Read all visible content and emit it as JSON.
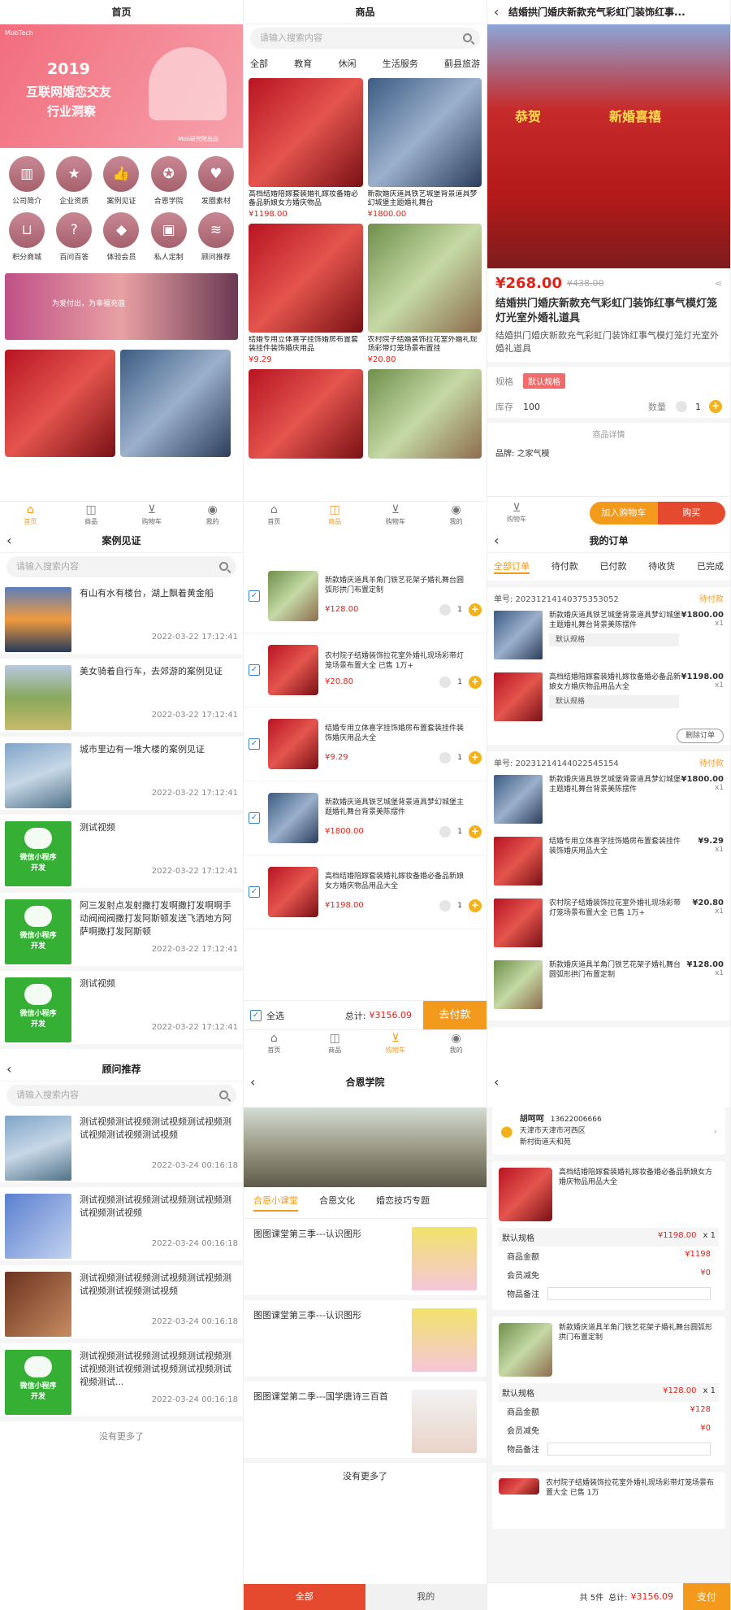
{
  "home": {
    "title": "首页",
    "banner_year": "2019",
    "banner_line1": "互联网婚恋交友",
    "banner_line2": "行业洞察",
    "banner_logo": "MobTech",
    "banner_sub": "Mob研究院出品",
    "icons": [
      {
        "label": "公司简介",
        "icon": "building-icon"
      },
      {
        "label": "企业资质",
        "icon": "star-icon"
      },
      {
        "label": "案例见证",
        "icon": "thumbs-up-icon"
      },
      {
        "label": "合恩学院",
        "icon": "medal-icon"
      },
      {
        "label": "发圈素材",
        "icon": "heart-icon"
      },
      {
        "label": "积分商城",
        "icon": "basket-icon"
      },
      {
        "label": "百问百答",
        "icon": "question-search-icon"
      },
      {
        "label": "体验会员",
        "icon": "graduation-cap-icon"
      },
      {
        "label": "私人定制",
        "icon": "gift-icon"
      },
      {
        "label": "顾问推荐",
        "icon": "layers-icon"
      }
    ],
    "couple_text": "为爱付出，为幸福充值",
    "tabs": [
      "首页",
      "商品",
      "购物车",
      "我的"
    ]
  },
  "goods": {
    "title": "商品",
    "search_placeholder": "请输入搜索内容",
    "tabs": [
      "全部",
      "教育",
      "休闲",
      "生活服务",
      "蓟县旅游"
    ],
    "items": [
      {
        "title": "高档结婚陪嫁套装婚礼嫁妆备婚必备品新娘女方婚庆物品",
        "price": "¥1198.00"
      },
      {
        "title": "新款婚庆道具铁艺城堡背景道具梦幻城堡主题婚礼舞台",
        "price": "¥1800.00"
      },
      {
        "title": "结婚专用立体喜字挂饰婚房布置套装挂件装饰婚庆用品",
        "price": "¥9.29"
      },
      {
        "title": "农村院子结婚装饰拉花室外婚礼现场彩带灯笼场景布置挂",
        "price": "¥20.80"
      }
    ]
  },
  "detail": {
    "title": "结婚拱门婚庆新款充气彩虹门装饰红事...",
    "price": "¥268.00",
    "orig_price": "¥438.00",
    "name": "结婚拱门婚庆新款充气彩虹门装饰红事气模灯笼灯光室外婚礼道具",
    "desc": "结婚拱门婚庆新款充气彩虹门装饰红事气模灯笼灯光室外婚礼道具",
    "spec_label": "规格",
    "spec_value": "默认规格",
    "stock_label": "库存",
    "stock": "100",
    "qty_label": "数量",
    "qty": "1",
    "detail_header": "商品详情",
    "brand": "品牌: 之家气模",
    "add_cart": "加入购物车",
    "buy": "购买",
    "shop_label": "购物车",
    "photo_text1": "恭贺",
    "photo_text2": "新婚喜禧"
  },
  "cases": {
    "title": "案例见证",
    "search_placeholder": "请输入搜索内容",
    "items": [
      {
        "text": "有山有水有楼台，湖上飘着黄金船",
        "time": "2022-03-22 17:12:41"
      },
      {
        "text": "美女骑着自行车，去郊游的案例见证",
        "time": "2022-03-22 17:12:41"
      },
      {
        "text": "城市里边有一堆大楼的案例见证",
        "time": "2022-03-22 17:12:41"
      },
      {
        "text": "测试视频",
        "time": "2022-03-22 17:12:41"
      },
      {
        "text": "阿三发射点发射撒打发啊撒打发啊啊手动阀阀阀撒打发阿斯顿发送飞洒地方阿萨啊撒打发阿斯顿",
        "time": "2022-03-22 17:12:41"
      },
      {
        "text": "测试视频",
        "time": "2022-03-22 17:12:41"
      }
    ],
    "wechat_line1": "微信小程序",
    "wechat_line2": "开发"
  },
  "cart": {
    "items": [
      {
        "title": "新款婚庆道具羊角门铁艺花架子婚礼舞台圆弧形拱门布置定制",
        "price": "¥128.00",
        "qty": "1"
      },
      {
        "title": "农村院子结婚装饰拉花室外婚礼现场彩带灯笼场景布置大全 已售 1万+",
        "price": "¥20.80",
        "qty": "1"
      },
      {
        "title": "结婚专用立体喜字挂饰婚房布置套装挂件装饰婚庆用品大全",
        "price": "¥9.29",
        "qty": "1"
      },
      {
        "title": "新款婚庆道具铁艺城堡背景道具梦幻城堡主题婚礼舞台背景美陈摆件",
        "price": "¥1800.00",
        "qty": "1"
      },
      {
        "title": "高档结婚陪嫁套装婚礼嫁妆备婚必备品新娘女方婚庆物品用品大全",
        "price": "¥1198.00",
        "qty": "1"
      }
    ],
    "select_all": "全选",
    "total_label": "总计:",
    "total": "¥3156.09",
    "checkout": "去付款",
    "tabs": [
      "首页",
      "商品",
      "购物车",
      "我的"
    ]
  },
  "orders": {
    "title": "我的订单",
    "tabs": [
      "全部订单",
      "待付款",
      "已付款",
      "待收货",
      "已完成"
    ],
    "order1": {
      "no": "单号: 20231214140375353052",
      "status": "待付款",
      "items": [
        {
          "title": "新款婚庆道具铁艺城堡背景道具梦幻城堡主题婚礼舞台背景美陈摆件",
          "price": "¥1800.00",
          "qty": "x1",
          "spec": "默认规格"
        },
        {
          "title": "高档结婚陪嫁套装婚礼嫁妆备婚必备品新娘女方婚庆物品用品大全",
          "price": "¥1198.00",
          "qty": "x1",
          "spec": "默认规格"
        }
      ],
      "delete": "删除订单"
    },
    "order2": {
      "no": "单号: 20231214144022545154",
      "status": "待付款",
      "items": [
        {
          "title": "新款婚庆道具铁艺城堡背景道具梦幻城堡主题婚礼舞台背景美陈摆件",
          "price": "¥1800.00",
          "qty": "x1"
        },
        {
          "title": "结婚专用立体喜字挂饰婚房布置套装挂件装饰婚庆用品大全",
          "price": "¥9.29",
          "qty": "x1"
        },
        {
          "title": "农村院子结婚装饰拉花室外婚礼现场彩带灯笼场景布置大全 已售 1万+",
          "price": "¥20.80",
          "qty": "x1"
        },
        {
          "title": "新款婚庆道具羊角门铁艺花架子婚礼舞台圆弧形拱门布置定制",
          "price": "¥128.00",
          "qty": "x1"
        }
      ]
    }
  },
  "advisors": {
    "title": "顾问推荐",
    "search_placeholder": "请输入搜索内容",
    "items": [
      {
        "text": "测试视频测试视频测试视频测试视频测试视频测试视频测试视频",
        "time": "2022-03-24 00:16:18"
      },
      {
        "text": "测试视频测试视频测试视频测试视频测试视频测试视频",
        "time": "2022-03-24 00:16:18"
      },
      {
        "text": "测试视频测试视频测试视频测试视频测试视频测试视频测试视频",
        "time": "2022-03-24 00:16:18"
      },
      {
        "text": "测试视频测试视频测试视频测试视频测试视频测试视频测试视频测试视频测试视频测试...",
        "time": "2022-03-24 00:16:18"
      }
    ],
    "more": "没有更多了"
  },
  "school": {
    "title": "合恩学院",
    "tabs": [
      "合恩小课堂",
      "合恩文化",
      "婚恋技巧专题"
    ],
    "courses": [
      "图图课堂第三季---认识图形",
      "图图课堂第三季---认识图形",
      "图图课堂第二季---国学唐诗三百首"
    ],
    "more": "没有更多了",
    "bottom_tabs": [
      "全部",
      "我的"
    ]
  },
  "checkout": {
    "name": "胡呵呵",
    "phone": "13622006666",
    "address": "天津市天津市河西区",
    "street": "新村街道天和苑",
    "items": [
      {
        "title": "高档结婚陪嫁套装婚礼嫁妆备婚必备品新娘女方婚庆物品用品大全",
        "spec": "默认规格",
        "price": "¥1198.00",
        "qty": "x 1",
        "amount": "¥1198",
        "discount": "¥0"
      },
      {
        "title": "新款婚庆道具羊角门铁艺花架子婚礼舞台圆弧形拱门布置定制",
        "spec": "默认规格",
        "price": "¥128.00",
        "qty": "x 1",
        "amount": "¥128",
        "discount": "¥0"
      }
    ],
    "third": "农村院子结婚装饰拉花室外婚礼现场彩带灯笼场景布置大全 已售 1万",
    "amount_label": "商品金额",
    "discount_label": "会员减免",
    "note_label": "物品备注",
    "count": "共 5件",
    "total_label": "总计:",
    "total": "¥3156.09",
    "pay": "支付"
  }
}
